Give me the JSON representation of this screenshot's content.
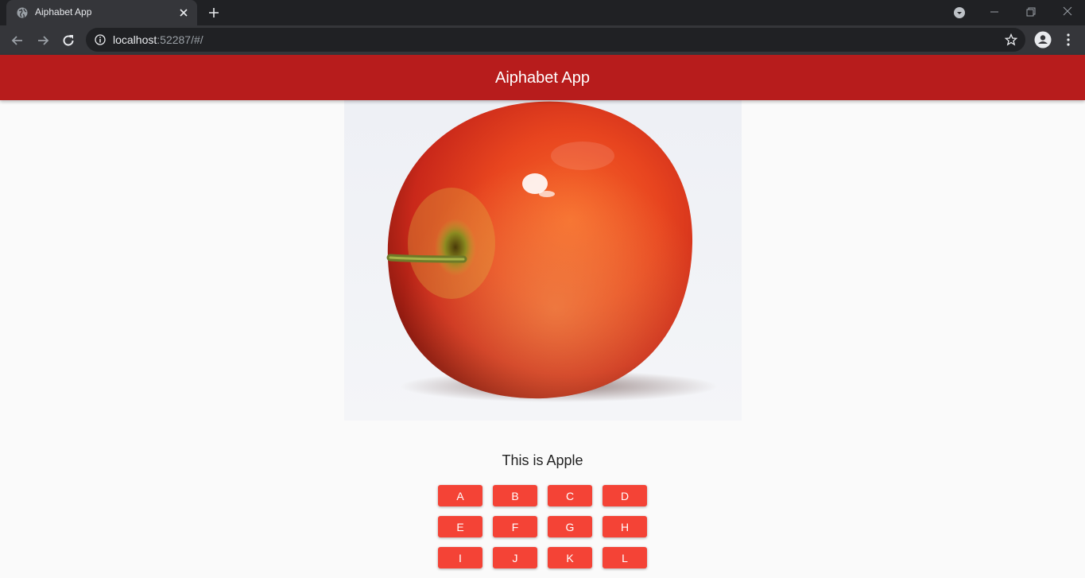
{
  "browser": {
    "tab_title": "Aiphabet App",
    "url_host": "localhost",
    "url_rest": ":52287/#/"
  },
  "app": {
    "title": "Aiphabet App",
    "caption": "This is Apple",
    "image_icon": "apple-photo",
    "accent_color": "#b71c1c",
    "button_color": "#f44336",
    "letters": [
      "A",
      "B",
      "C",
      "D",
      "E",
      "F",
      "G",
      "H",
      "I",
      "J",
      "K",
      "L"
    ]
  }
}
